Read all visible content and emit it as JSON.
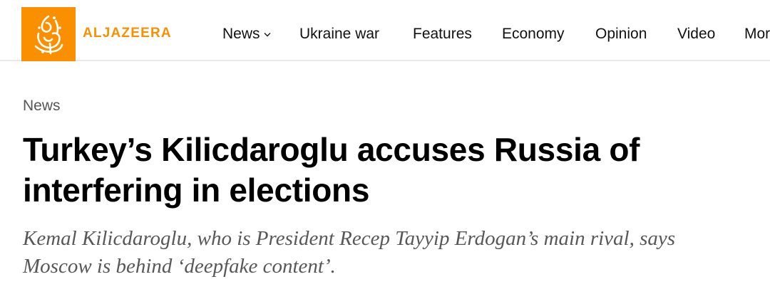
{
  "header": {
    "brand": "ALJAZEERA",
    "accent_color": "#fa9000",
    "logo_icon": "aljazeera-calligraphy-logo",
    "nav": [
      {
        "label": "News",
        "has_dropdown": true
      },
      {
        "label": "Ukraine war"
      },
      {
        "label": "Features"
      },
      {
        "label": "Economy"
      },
      {
        "label": "Opinion"
      },
      {
        "label": "Video"
      },
      {
        "label": "Mor"
      }
    ]
  },
  "article": {
    "section": "News",
    "headline": "Turkey’s Kilicdaroglu accuses Russia of interfering in elections",
    "standfirst": "Kemal Kilicdaroglu, who is President Recep Tayyip Erdogan’s main rival, says Moscow is behind ‘deepfake content’."
  }
}
